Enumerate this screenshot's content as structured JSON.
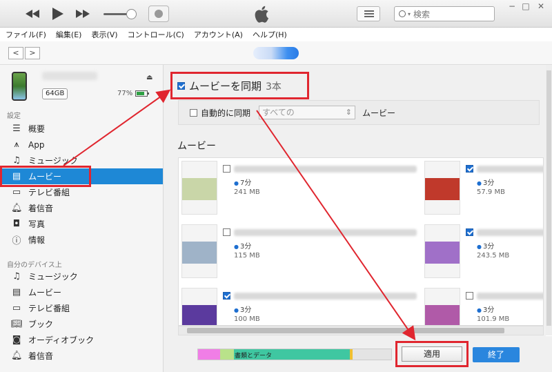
{
  "toolbar": {
    "search_placeholder": "検索",
    "win_min": "−",
    "win_max": "□",
    "win_close": "✕"
  },
  "menu": [
    "ファイル(F)",
    "編集(E)",
    "表示(V)",
    "コントロール(C)",
    "アカウント(A)",
    "ヘルプ(H)"
  ],
  "nav": {
    "back": "<",
    "forward": ">"
  },
  "device": {
    "capacity": "64GB",
    "battery": "77%"
  },
  "sidebar": {
    "settings_label": "設定",
    "settings_items": [
      {
        "label": "概要",
        "icon": "summary-icon"
      },
      {
        "label": "App",
        "icon": "app-icon"
      },
      {
        "label": "ミュージック",
        "icon": "music-icon"
      },
      {
        "label": "ムービー",
        "icon": "movie-icon"
      },
      {
        "label": "テレビ番組",
        "icon": "tv-icon"
      },
      {
        "label": "着信音",
        "icon": "bell-icon"
      },
      {
        "label": "写真",
        "icon": "camera-icon"
      },
      {
        "label": "情報",
        "icon": "info-icon"
      }
    ],
    "mydevice_label": "自分のデバイス上",
    "mydevice_items": [
      {
        "label": "ミュージック",
        "icon": "music-icon"
      },
      {
        "label": "ムービー",
        "icon": "movie-icon"
      },
      {
        "label": "テレビ番組",
        "icon": "tv-icon"
      },
      {
        "label": "ブック",
        "icon": "book-icon"
      },
      {
        "label": "オーディオブック",
        "icon": "audiobook-icon"
      },
      {
        "label": "着信音",
        "icon": "bell-icon"
      }
    ]
  },
  "content": {
    "sync_label": "ムービーを同期",
    "sync_count": "3本",
    "auto_label": "自動的に同期",
    "auto_select": "すべての",
    "auto_suffix": "ムービー",
    "movies_heading": "ムービー",
    "movies": [
      {
        "duration": "7分",
        "size": "241 MB",
        "checked": false,
        "color": "#c9d6a8"
      },
      {
        "duration": "3分",
        "size": "57.9 MB",
        "checked": true,
        "color": "#c0392b"
      },
      {
        "duration": "3分",
        "size": "115 MB",
        "checked": false,
        "color": "#9fb3c8"
      },
      {
        "duration": "3分",
        "size": "243.5 MB",
        "checked": true,
        "color": "#a070c8"
      },
      {
        "duration": "3分",
        "size": "100 MB",
        "checked": true,
        "color": "#5b3a9e"
      },
      {
        "duration": "3分",
        "size": "101.9 MB",
        "checked": false,
        "color": "#b05aa8"
      }
    ]
  },
  "bottom": {
    "capacity_label": "書類とデータ",
    "apply": "適用",
    "done": "終了"
  }
}
